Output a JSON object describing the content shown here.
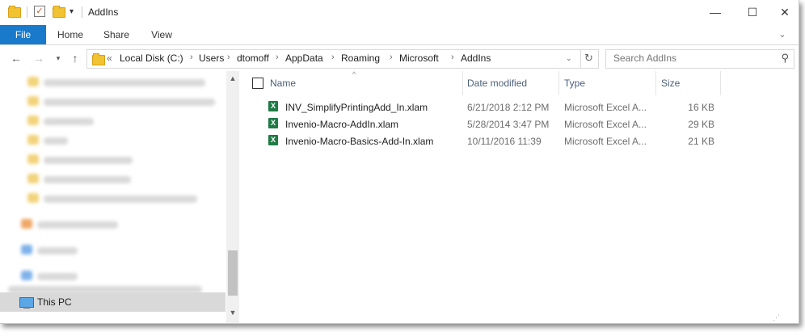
{
  "window": {
    "title": "AddIns",
    "buttons": {
      "minimize": "—",
      "maximize": "☐",
      "close": "✕"
    }
  },
  "ribbon": {
    "tabs": [
      {
        "label": "File"
      },
      {
        "label": "Home"
      },
      {
        "label": "Share"
      },
      {
        "label": "View"
      }
    ],
    "expand_icon": "chevron-down-icon"
  },
  "navigation": {
    "back_icon": "back-arrow-icon",
    "forward_icon": "forward-arrow-icon",
    "recent_icon": "chevron-down-icon",
    "up_icon": "up-arrow-icon",
    "overflow": "«",
    "path": [
      "Local Disk (C:)",
      "Users",
      "dtomoff",
      "AppData",
      "Roaming",
      "Microsoft",
      "AddIns"
    ],
    "separator": "›",
    "search_placeholder": "Search AddIns"
  },
  "nav_pane": {
    "selected_item": "This PC"
  },
  "file_list": {
    "columns": {
      "name": "Name",
      "date": "Date modified",
      "type": "Type",
      "size": "Size"
    },
    "files": [
      {
        "name": "INV_SimplifyPrintingAdd_In.xlam",
        "date": "6/21/2018 2:12 PM",
        "type": "Microsoft Excel A...",
        "size": "16 KB"
      },
      {
        "name": "Invenio-Macro-AddIn.xlam",
        "date": "5/28/2014 3:47 PM",
        "type": "Microsoft Excel A...",
        "size": "29 KB"
      },
      {
        "name": "Invenio-Macro-Basics-Add-In.xlam",
        "date": "10/11/2016 11:39",
        "type": "Microsoft Excel A...",
        "size": "21 KB"
      }
    ],
    "file_icon": "excel-file-icon"
  },
  "colors": {
    "accent": "#1979ca",
    "selection": "#d9d9d9",
    "excel": "#1f7a45",
    "folder": "#f1c232",
    "header_text": "#4c607a"
  }
}
